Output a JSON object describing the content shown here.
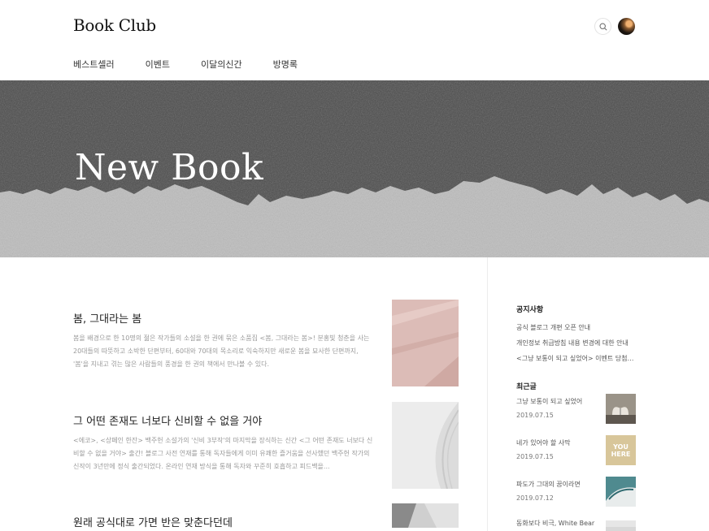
{
  "header": {
    "logo": "Book Club",
    "nav": [
      "베스트셀러",
      "이벤트",
      "이달의신간",
      "방명록"
    ]
  },
  "hero": {
    "title": "New Book"
  },
  "posts": [
    {
      "title": "봄, 그대라는 봄",
      "excerpt": "봄을 배경으로 한 10명의 젊은 작가들의 소설을 한 권에 묶은 소품집 <봄, 그대라는 봄>! 분홍빛 청춘을 사는 20대들의 따뜻하고 소박한 단편부터, 60대와 70대의 목소리로 익숙하지만 새로운 봄을 묘사한 단편까지, '봄'을 지내고 겪는 많은 사람들의 풍경을 한 권의 책에서 만나볼 수 있다."
    },
    {
      "title": "그 어떤 존재도 너보다 신비할 수 없을 거야",
      "excerpt": "<에코>, <상페인 한잔> 백주헌 소설가의 '신비 3부작'의 마지막을 장식하는 신간 <그 어떤 존재도 너보다 신비할 수 없을 거야> 출간! 블로그 사전 연재를 통해 독자들에게 이미 유쾌한 즐거움을 선사했던 백주헌 작가의 신작이 3년만에 정식 출간되었다. 온라인 연재 방식을 통해 독자와 꾸준히 호흡하고 피드백을..."
    },
    {
      "title": "원래 공식대로 가면 반은 맞춘다던데",
      "excerpt": ""
    }
  ],
  "sidebar": {
    "notice_heading": "공지사항",
    "notices": [
      "공식 블로그 개편 오픈 안내",
      "개인정보 취급방침 내용 변경에 대한 안내",
      "<그냥 보통이 되고 싶었어> 이벤트 당첨자..."
    ],
    "recent_heading": "최근글",
    "recent": [
      {
        "title": "그냥 보통이 되고 싶었어",
        "date": "2019.07.15"
      },
      {
        "title": "네가 있어야 할 사막",
        "date": "2019.07.15"
      },
      {
        "title": "파도가 그대의 꿈이라면",
        "date": "2019.07.12"
      },
      {
        "title": "동화보다 비극, White Bear",
        "date": ""
      }
    ],
    "recent_thumb_text": "YOU HERE"
  },
  "colors": {
    "hero_dark": "#4a4a4a",
    "hero_light": "#bcbcbc",
    "thumb_pink": "#dcbcb7"
  }
}
